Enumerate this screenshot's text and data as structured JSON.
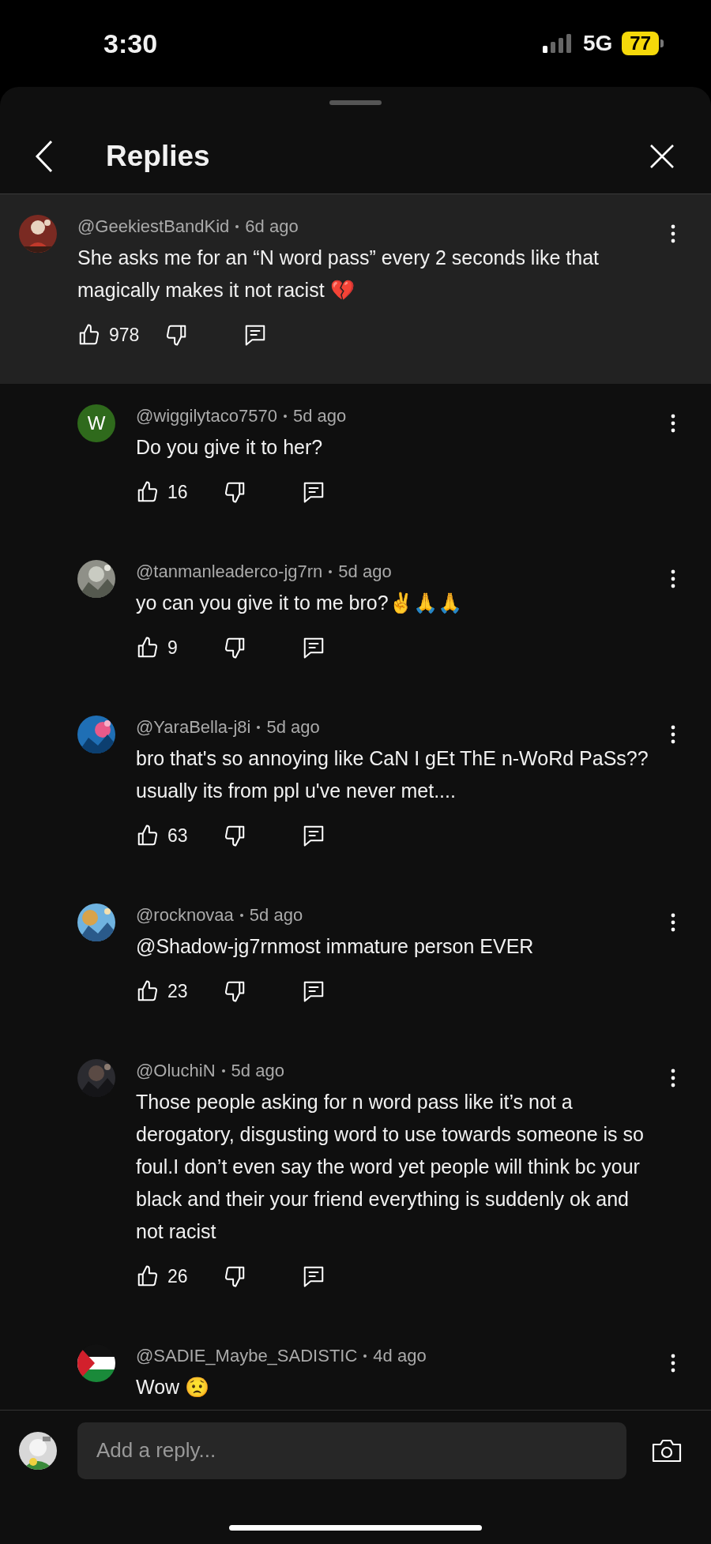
{
  "status_bar": {
    "time": "3:30",
    "network": "5G",
    "battery": "77"
  },
  "header": {
    "title": "Replies"
  },
  "comment": {
    "author": "@GeekiestBandKid",
    "time": "6d ago",
    "text": "She asks me for an “N word pass” every 2 seconds like that magically makes it not racist 💔",
    "likes": "978"
  },
  "replies": [
    {
      "author": "@wiggilytaco7570",
      "time": "5d ago",
      "text": "Do you give it to her?",
      "likes": "16",
      "avatar": {
        "kind": "letter",
        "letter": "W",
        "color": "#2f6a1c"
      }
    },
    {
      "author": "@tanmanleaderco-jg7rn",
      "time": "5d ago",
      "text": "yo can you give it to me bro?✌️🙏🙏",
      "likes": "9"
    },
    {
      "author": "@YaraBella-j8i",
      "time": "5d ago",
      "text": "bro that's so annoying like CaN I gEt ThE n-WoRd PaSs?? usually its from ppl u've never met....",
      "likes": "63"
    },
    {
      "author": "@rocknovaa",
      "time": "5d ago",
      "text": "@Shadow-jg7rnmost immature person EVER",
      "likes": "23"
    },
    {
      "author": "@OluchiN",
      "time": "5d ago",
      "text": "Those people asking for n word pass like it’s not a derogatory, disgusting word to use towards someone is so foul.I don’t even say the word yet people will think bc your black and their your friend everything is suddenly ok and not racist",
      "likes": "26"
    },
    {
      "author": "@SADIE_Maybe_SADISTIC",
      "time": "4d ago",
      "text": "Wow 😟",
      "avatar": {
        "kind": "flag"
      }
    }
  ],
  "composer": {
    "placeholder": "Add a reply..."
  }
}
